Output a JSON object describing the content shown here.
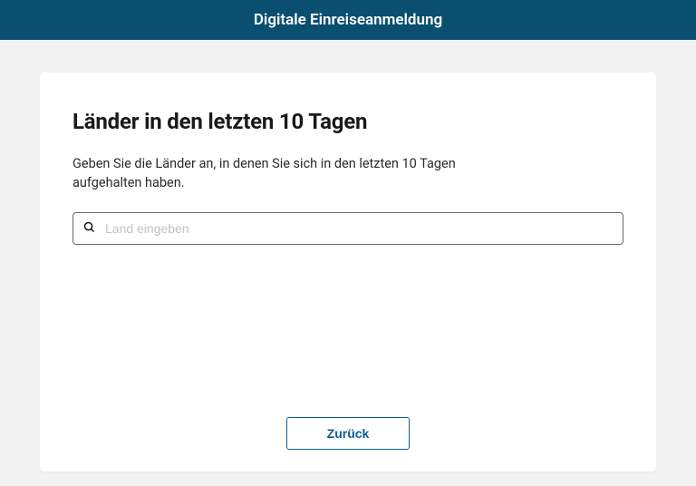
{
  "header": {
    "title": "Digitale Einreiseanmeldung"
  },
  "main": {
    "heading": "Länder in den letzten 10 Tagen",
    "description": "Geben Sie die Länder an, in denen Sie sich in den letzten 10 Tagen aufgehalten haben.",
    "search_placeholder": "Land eingeben",
    "back_label": "Zurück"
  }
}
